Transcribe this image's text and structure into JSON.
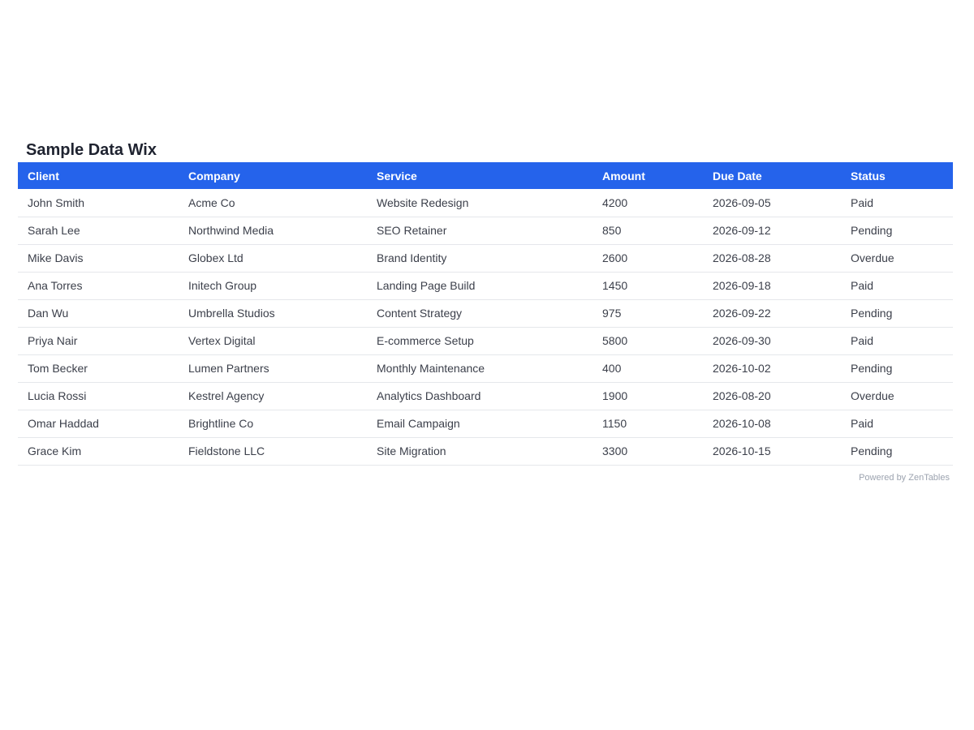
{
  "widget": {
    "title": "Sample Data Wix",
    "footer": "Powered by ZenTables"
  },
  "table": {
    "headers": {
      "client": "Client",
      "company": "Company",
      "service": "Service",
      "amount": "Amount",
      "due_date": "Due Date",
      "status": "Status"
    },
    "rows": [
      {
        "client": "John Smith",
        "company": "Acme Co",
        "service": "Website Redesign",
        "amount": "4200",
        "due_date": "2026-09-05",
        "status": "Paid"
      },
      {
        "client": "Sarah Lee",
        "company": "Northwind Media",
        "service": "SEO Retainer",
        "amount": "850",
        "due_date": "2026-09-12",
        "status": "Pending"
      },
      {
        "client": "Mike Davis",
        "company": "Globex Ltd",
        "service": "Brand Identity",
        "amount": "2600",
        "due_date": "2026-08-28",
        "status": "Overdue"
      },
      {
        "client": "Ana Torres",
        "company": "Initech Group",
        "service": "Landing Page Build",
        "amount": "1450",
        "due_date": "2026-09-18",
        "status": "Paid"
      },
      {
        "client": "Dan Wu",
        "company": "Umbrella Studios",
        "service": "Content Strategy",
        "amount": "975",
        "due_date": "2026-09-22",
        "status": "Pending"
      },
      {
        "client": "Priya Nair",
        "company": "Vertex Digital",
        "service": "E-commerce Setup",
        "amount": "5800",
        "due_date": "2026-09-30",
        "status": "Paid"
      },
      {
        "client": "Tom Becker",
        "company": "Lumen Partners",
        "service": "Monthly Maintenance",
        "amount": "400",
        "due_date": "2026-10-02",
        "status": "Pending"
      },
      {
        "client": "Lucia Rossi",
        "company": "Kestrel Agency",
        "service": "Analytics Dashboard",
        "amount": "1900",
        "due_date": "2026-08-20",
        "status": "Overdue"
      },
      {
        "client": "Omar Haddad",
        "company": "Brightline Co",
        "service": "Email Campaign",
        "amount": "1150",
        "due_date": "2026-10-08",
        "status": "Paid"
      },
      {
        "client": "Grace Kim",
        "company": "Fieldstone LLC",
        "service": "Site Migration",
        "amount": "3300",
        "due_date": "2026-10-15",
        "status": "Pending"
      }
    ]
  },
  "colors": {
    "header_background": "#2563eb",
    "header_text": "#ffffff",
    "title_text": "#1f2330",
    "row_divider": "#e5e7eb",
    "footer_text": "#9ca3af"
  }
}
